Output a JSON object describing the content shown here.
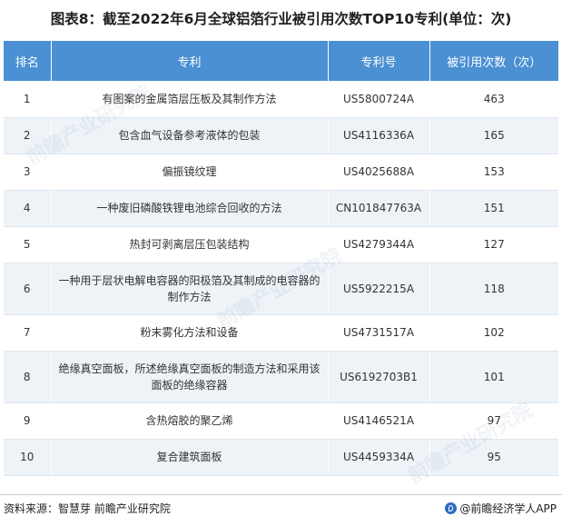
{
  "title": "图表8：截至2022年6月全球铝箔行业被引用次数TOP10专利(单位：次)",
  "table": {
    "headers": [
      "排名",
      "专利",
      "专利号",
      "被引用次数（次）"
    ],
    "rows": [
      {
        "rank": "1",
        "patent": "有图案的金属箔层压板及其制作方法",
        "number": "US5800724A",
        "citations": "463"
      },
      {
        "rank": "2",
        "patent": "包含血气设备参考液体的包装",
        "number": "US4116336A",
        "citations": "165"
      },
      {
        "rank": "3",
        "patent": "偏振镜纹理",
        "number": "US4025688A",
        "citations": "153"
      },
      {
        "rank": "4",
        "patent": "一种废旧磷酸铁锂电池综合回收的方法",
        "number": "CN101847763A",
        "citations": "151"
      },
      {
        "rank": "5",
        "patent": "热封可剥离层压包装结构",
        "number": "US4279344A",
        "citations": "127"
      },
      {
        "rank": "6",
        "patent": "一种用于层状电解电容器的阳极箔及其制成的电容器的制作方法",
        "number": "US5922215A",
        "citations": "118"
      },
      {
        "rank": "7",
        "patent": "粉末雾化方法和设备",
        "number": "US4731517A",
        "citations": "102"
      },
      {
        "rank": "8",
        "patent": "绝缘真空面板，所述绝缘真空面板的制造方法和采用该面板的绝缘容器",
        "number": "US6192703B1",
        "citations": "101"
      },
      {
        "rank": "9",
        "patent": "含热熔胶的聚乙烯",
        "number": "US4146521A",
        "citations": "97"
      },
      {
        "rank": "10",
        "patent": "复合建筑面板",
        "number": "US4459334A",
        "citations": "95"
      }
    ]
  },
  "footer": {
    "source": "资料来源：智慧芽 前瞻产业研究院",
    "brand": "@前瞻经济学人APP",
    "brand_icon": "qianzhan-logo-icon"
  },
  "watermark": "前瞻产业研究院",
  "colors": {
    "header_bg": "#4a90d2",
    "row_alt_bg": "#eef3f8",
    "brand_blue": "#2b6cc4"
  }
}
